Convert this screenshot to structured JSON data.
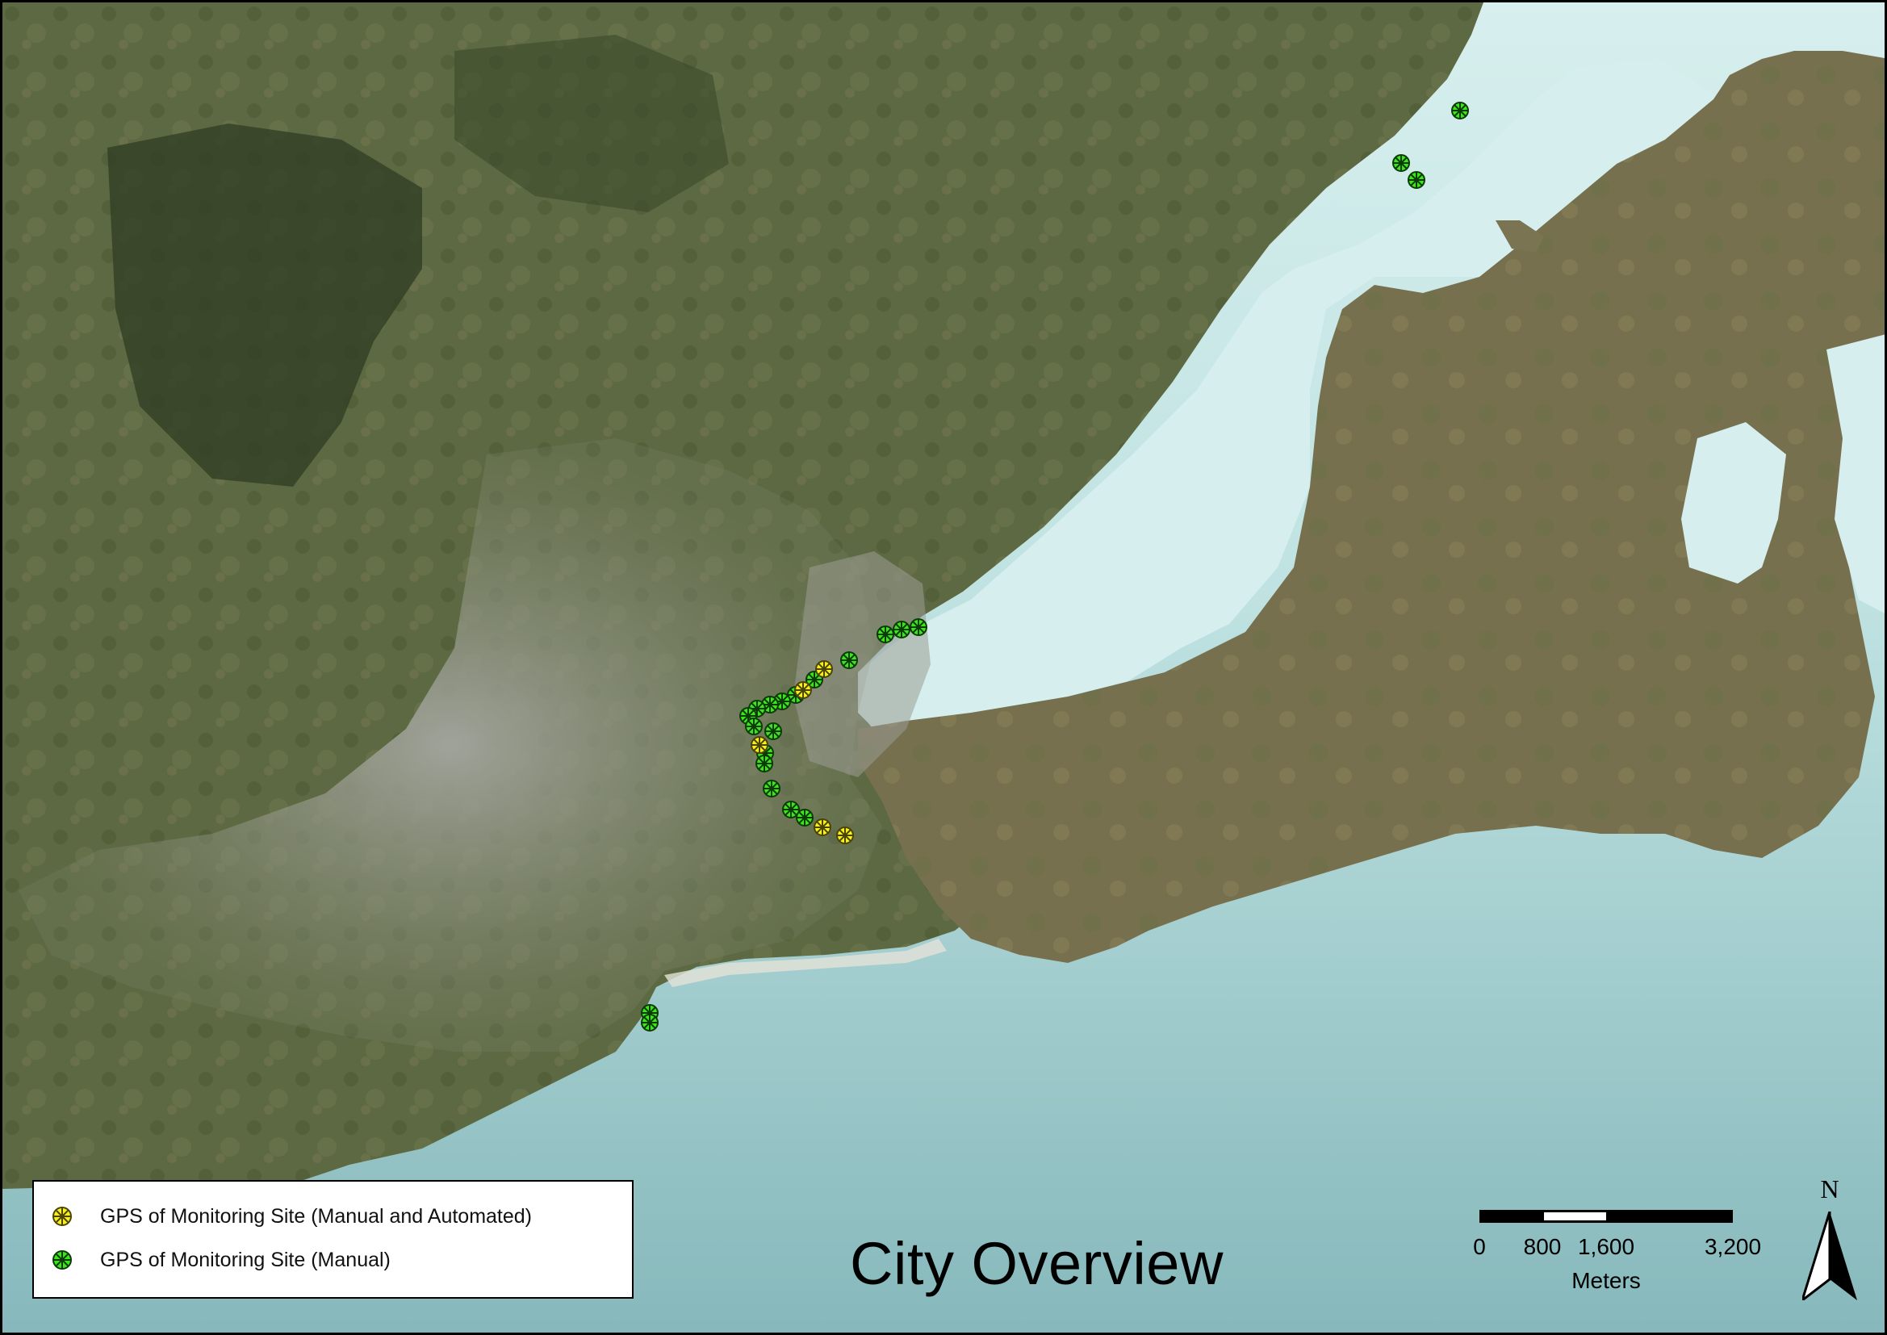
{
  "map": {
    "title": "City Overview",
    "land_color": "#5f6b44",
    "urban_color": "#8d9186",
    "water_color": "#d6efee",
    "deep_water_color": "#8cc0c2"
  },
  "legend": {
    "items": [
      {
        "label": "GPS of Monitoring Site (Manual and Automated)",
        "color": "#f7f01c",
        "icon": "asterisk-marker-icon"
      },
      {
        "label": "GPS of Monitoring Site (Manual)",
        "color": "#3fe41f",
        "icon": "asterisk-marker-icon"
      }
    ]
  },
  "scale_bar": {
    "labels": [
      "0",
      "800",
      "1,600",
      "3,200"
    ],
    "unit": "Meters"
  },
  "north_arrow": {
    "letter": "N",
    "icon": "north-arrow-icon"
  },
  "sites": {
    "manual_count": 24,
    "manual_and_automated_count": 6
  }
}
